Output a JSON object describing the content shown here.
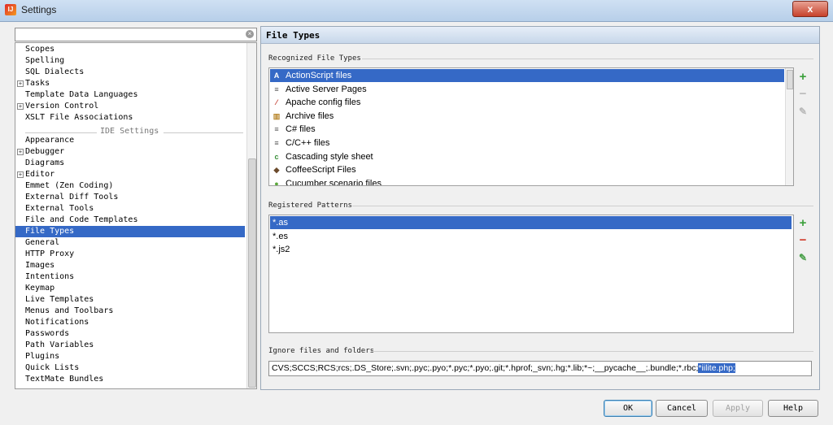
{
  "window": {
    "title": "Settings",
    "icon_label": "IJ",
    "close": "x"
  },
  "search": {
    "value": "",
    "placeholder": ""
  },
  "tree": {
    "items_top": [
      {
        "label": "Scopes",
        "expandable": false
      },
      {
        "label": "Spelling",
        "expandable": false
      },
      {
        "label": "SQL Dialects",
        "expandable": false
      },
      {
        "label": "Tasks",
        "expandable": true
      },
      {
        "label": "Template Data Languages",
        "expandable": false
      },
      {
        "label": "Version Control",
        "expandable": true
      },
      {
        "label": "XSLT File Associations",
        "expandable": false
      }
    ],
    "separator": "IDE Settings",
    "items_ide": [
      {
        "label": "Appearance",
        "expandable": false
      },
      {
        "label": "Debugger",
        "expandable": true
      },
      {
        "label": "Diagrams",
        "expandable": false
      },
      {
        "label": "Editor",
        "expandable": true
      },
      {
        "label": "Emmet (Zen Coding)",
        "expandable": false
      },
      {
        "label": "External Diff Tools",
        "expandable": false
      },
      {
        "label": "External Tools",
        "expandable": false
      },
      {
        "label": "File and Code Templates",
        "expandable": false
      },
      {
        "label": "File Types",
        "expandable": false,
        "selected": true
      },
      {
        "label": "General",
        "expandable": false
      },
      {
        "label": "HTTP Proxy",
        "expandable": false
      },
      {
        "label": "Images",
        "expandable": false
      },
      {
        "label": "Intentions",
        "expandable": false
      },
      {
        "label": "Keymap",
        "expandable": false
      },
      {
        "label": "Live Templates",
        "expandable": false
      },
      {
        "label": "Menus and Toolbars",
        "expandable": false
      },
      {
        "label": "Notifications",
        "expandable": false
      },
      {
        "label": "Passwords",
        "expandable": false
      },
      {
        "label": "Path Variables",
        "expandable": false
      },
      {
        "label": "Plugins",
        "expandable": false
      },
      {
        "label": "Quick Lists",
        "expandable": false
      },
      {
        "label": "TextMate Bundles",
        "expandable": false
      }
    ]
  },
  "panel": {
    "title": "File Types",
    "recognized_label": "Recognized File Types",
    "file_types": [
      {
        "label": "ActionScript files",
        "icon": "actionscript-icon",
        "glyph": "A",
        "color": "#d9532b",
        "selected": true
      },
      {
        "label": "Active Server Pages",
        "icon": "asp-icon",
        "glyph": "≡",
        "color": "#555555"
      },
      {
        "label": "Apache config files",
        "icon": "apache-icon",
        "glyph": "⁄",
        "color": "#c0392b"
      },
      {
        "label": "Archive files",
        "icon": "archive-icon",
        "glyph": "▥",
        "color": "#b8862b"
      },
      {
        "label": "C# files",
        "icon": "csharp-icon",
        "glyph": "≡",
        "color": "#555555"
      },
      {
        "label": "C/C++ files",
        "icon": "cpp-icon",
        "glyph": "≡",
        "color": "#555555"
      },
      {
        "label": "Cascading style sheet",
        "icon": "css-icon",
        "glyph": "c",
        "color": "#3a8f3a"
      },
      {
        "label": "CoffeeScript Files",
        "icon": "coffeescript-icon",
        "glyph": "◆",
        "color": "#6b4a2b"
      },
      {
        "label": "Cucumber scenario files",
        "icon": "cucumber-icon",
        "glyph": "●",
        "color": "#5aa83a"
      }
    ],
    "patterns_label": "Registered Patterns",
    "patterns": [
      {
        "label": "*.as",
        "selected": true
      },
      {
        "label": "*.es"
      },
      {
        "label": "*.js2"
      }
    ],
    "ignore_label": "Ignore files and folders",
    "ignore_value": "CVS;SCCS;RCS;rcs;.DS_Store;.svn;.pyc;.pyo;*.pyc;*.pyo;.git;*.hprof;_svn;.hg;*.lib;*~;__pycache__;.bundle;*.rbc;",
    "ignore_selected": "*iilite.php;",
    "side_icons": {
      "add": "+",
      "remove": "−",
      "edit": "✎"
    }
  },
  "buttons": {
    "ok": "OK",
    "cancel": "Cancel",
    "apply": "Apply",
    "help": "Help"
  }
}
